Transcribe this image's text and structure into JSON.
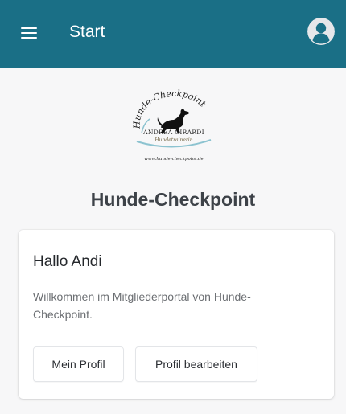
{
  "appbar": {
    "title": "Start",
    "menu_icon": "hamburger-menu-icon",
    "avatar_icon": "user-avatar-icon",
    "background_color": "#1a6f86"
  },
  "logo": {
    "title_text": "Hunde-Checkpoint",
    "name_text": "ANDREA GIRARDI",
    "subtitle": "Hundetrainerin",
    "url": "www.hunde-checkpoint.de"
  },
  "main": {
    "headline": "Hunde-Checkpoint"
  },
  "card": {
    "greeting": "Hallo Andi",
    "welcome_text": "Willkommen im Mitgliederportal von Hunde-Checkpoint.",
    "buttons": {
      "profile": "Mein Profil",
      "edit_profile": "Profil bearbeiten"
    }
  }
}
